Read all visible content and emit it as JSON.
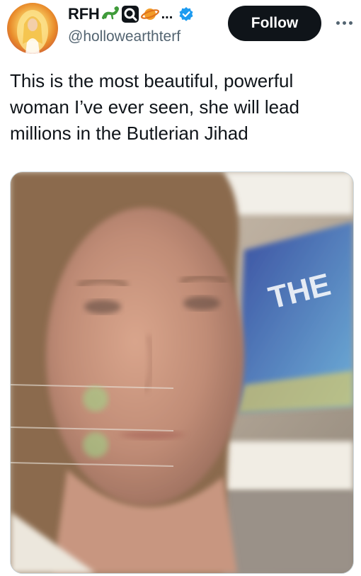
{
  "tweet": {
    "author": {
      "display_name": "RFH",
      "name_emojis": [
        "lizard-emoji",
        "magnifier-emoji",
        "planet-emoji"
      ],
      "ellipsis": "...",
      "handle": "@hollowearthterf",
      "verified": true,
      "verified_color": "#1d9bf0"
    },
    "follow_label": "Follow",
    "more_icon": "more-dots-icon",
    "text": "This is the most beautiful, powerful woman I’ve ever seen, she will lead millions in the Butlerian Jihad",
    "media": {
      "type": "video-frame",
      "overlay_text": "THE"
    }
  }
}
